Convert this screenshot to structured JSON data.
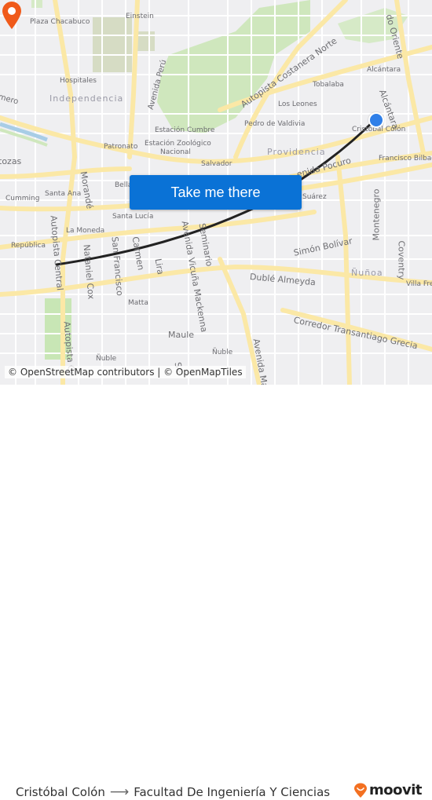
{
  "map": {
    "labels": {
      "plaza_chacabuco": "Plaza Chacabuco",
      "einstein": "Einstein",
      "hospitales": "Hospitales",
      "independencia": "Independencia",
      "mero": "mero",
      "avenida_peru": "Avenida Perú",
      "autopista_costanera_norte": "Autopista Costanera Norte",
      "oriente": "do Oriente",
      "alcantara_1": "Alcántara",
      "alcantara_2": "Alcántara",
      "tobalaba": "Tobalaba",
      "los_leones": "Los Leones",
      "pedro_de_valdivia": "Pedro de Valdivia",
      "cristobal_colon": "Cristóbal Colón",
      "estacion_cumbre": "Estación Cumbre",
      "estacion_zoologico": "Estación Zoológico",
      "nacional": "Nacional",
      "patronato": "Patronato",
      "providencia": "Providencia",
      "francisco_bilbao": "Francisco Bilbao",
      "zozas": "tozas",
      "salvador": "Salvador",
      "pocuro": "enida Pocuro",
      "morande": "Morandé",
      "bella": "Bella",
      "santa_ana": "Santa Ana",
      "cumming": "Cumming",
      "suarez": "Suárez",
      "santa_lucia": "Santa Lucía",
      "la_moneda": "La Moneda",
      "republica": "República",
      "autopista_central": "Autopista Central",
      "nataniel_cox": "Nataniel Cox",
      "san_francisco": "San Francisco",
      "carmen": "Carmen",
      "lira": "Lira",
      "vicuna_mackenna": "Avenida Vicuña Mackenna",
      "seminario": "Seminario",
      "simon_bolivar": "Simón Bolívar",
      "montenegro": "Montenegro",
      "coventry": "Coventry",
      "nunoa": "Ñuñoa",
      "duble_almeyda": "Dublé Almeyda",
      "villa_frei": "Villa Frei",
      "matta": "Matta",
      "corredor": "Corredor Transantiago Grecia",
      "maule": "Maule",
      "autopista_central_2": "Autopista Ce",
      "nuble_1": "Ñuble",
      "nuble_2": "Ñuble",
      "avenida_mar": "Avenida Mar",
      "se": "Se"
    },
    "origin_marker": "origin-dot",
    "destination_marker": "destination-pin"
  },
  "cta": {
    "label": "Take me there"
  },
  "attribution": "© OpenStreetMap contributors | © OpenMapTiles",
  "footer": {
    "origin": "Cristóbal Colón",
    "arrow": "⟶",
    "destination": "Facultad De Ingeniería Y Ciencias",
    "brand": "moovit"
  },
  "colors": {
    "button": "#0a72d6",
    "origin": "#2f7fe8",
    "destination": "#f05a1a",
    "route": "#222222",
    "brand_orange": "#f37021"
  }
}
